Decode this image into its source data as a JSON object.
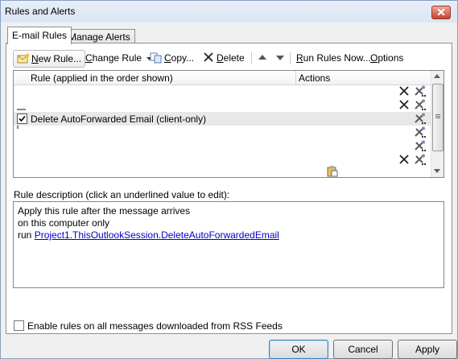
{
  "window": {
    "title": "Rules and Alerts"
  },
  "tabs": [
    {
      "label": "E-mail Rules",
      "active": true
    },
    {
      "label": "Manage Alerts",
      "active": false
    }
  ],
  "toolbar": {
    "new_rule": "New Rule...",
    "change_rule": "Change Rule",
    "copy": "Copy...",
    "delete": "Delete",
    "run_rules_now": "Run Rules Now...",
    "options": "Options"
  },
  "rules_list": {
    "columns": [
      "Rule (applied in the order shown)",
      "Actions"
    ],
    "rows": [
      {
        "label": "",
        "checked": false,
        "selected": false,
        "actions": [
          "delete-x-icon",
          "forward-tools-icon"
        ]
      },
      {
        "label": "",
        "checked": false,
        "selected": false,
        "actions": [
          "delete-x-icon",
          "forward-tools-icon"
        ]
      },
      {
        "label": "Delete AutoForwarded Email  (client-only)",
        "checked": true,
        "selected": true,
        "actions": [
          "forward-tools-icon"
        ]
      },
      {
        "label": "",
        "checked": false,
        "selected": false,
        "actions": [
          "forward-tools-icon"
        ]
      },
      {
        "label": "",
        "checked": false,
        "selected": false,
        "actions": [
          "forward-tools-icon"
        ]
      },
      {
        "label": "",
        "checked": false,
        "selected": false,
        "actions": [
          "delete-x-icon",
          "forward-tools-icon"
        ]
      }
    ]
  },
  "description": {
    "label": "Rule description (click an underlined value to edit):",
    "lines": [
      "Apply this rule after the message arrives",
      "on this computer only"
    ],
    "run_prefix": "run ",
    "run_link": "Project1.ThisOutlookSession.DeleteAutoForwardedEmail"
  },
  "rss_option": {
    "label": "Enable rules on all messages downloaded from RSS Feeds",
    "checked": false
  },
  "buttons": {
    "ok": "OK",
    "cancel": "Cancel",
    "apply": "Apply"
  },
  "colors": {
    "title_bar": "#dbe6f4",
    "close_button": "#c8412c",
    "link": "#0000cc",
    "selected_row": "#e8e8e8"
  }
}
